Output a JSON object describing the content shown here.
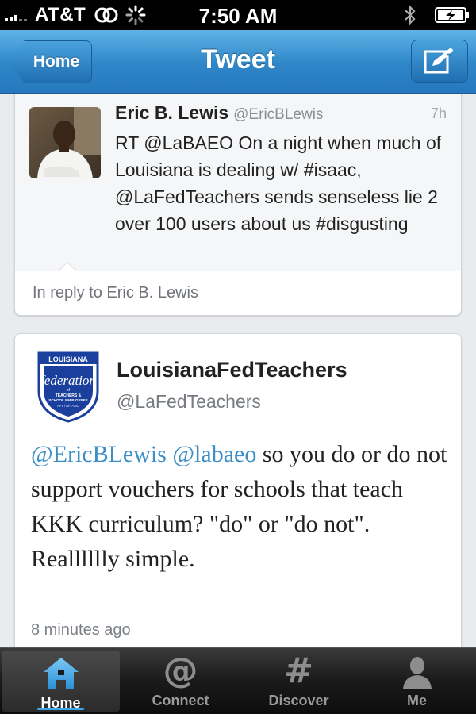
{
  "status_bar": {
    "carrier": "AT&T",
    "time": "7:50 AM"
  },
  "nav": {
    "back_label": "Home",
    "title": "Tweet"
  },
  "original_tweet": {
    "name": "Eric B. Lewis",
    "handle": "@EricBLewis",
    "age": "7h",
    "text": "RT @LaBAEO On a night when much of Louisiana is dealing w/ #isaac, @LaFedTeachers sends senseless lie 2 over 100 users about us #disgusting",
    "reply_context": "In reply to Eric B. Lewis"
  },
  "tweet": {
    "name": "LouisianaFedTeachers",
    "handle": "@LaFedTeachers",
    "mention_1": "@EricBLewis",
    "mention_2": "@labaeo",
    "text_rest": " so you do or do not support vouchers for schools that teach KKK curriculum? \"do\" or \"do not\". Realllllly simple.",
    "timestamp": "8 minutes ago",
    "logo_text": {
      "top": "LOUISIANA",
      "main": "federation",
      "of": "of",
      "line1": "TEACHERS &",
      "line2": "SCHOOL EMPLOYEES",
      "line3": "AFT / AFL-CIO"
    }
  },
  "tabs": [
    {
      "label": "Home",
      "icon": "home-icon",
      "active": true
    },
    {
      "label": "Connect",
      "icon": "at-icon",
      "active": false
    },
    {
      "label": "Discover",
      "icon": "hash-icon",
      "active": false
    },
    {
      "label": "Me",
      "icon": "person-icon",
      "active": false
    }
  ],
  "colors": {
    "nav_blue": "#2e86c8",
    "mention_blue": "#3b8ec6",
    "logo_blue": "#1a3f9c",
    "tab_active_blue": "#3fa6e8"
  }
}
